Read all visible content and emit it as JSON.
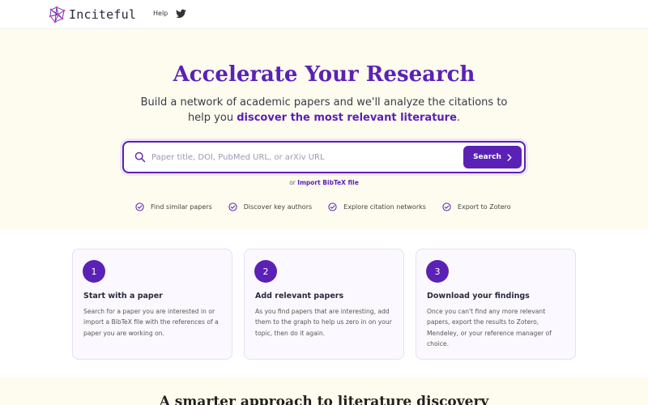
{
  "brand": {
    "name": "Inciteful",
    "accent": "#5b21b6"
  },
  "nav": {
    "help": "Help",
    "twitter_icon": "twitter-icon"
  },
  "hero": {
    "title": "Accelerate Your Research",
    "sub_line1": "Build a network of academic papers and we'll analyze the citations to",
    "sub_line2_prefix": "help you ",
    "sub_line2_bold": "discover the most relevant literature",
    "sub_line2_suffix": "."
  },
  "search": {
    "placeholder": "Paper title, DOI, PubMed URL, or arXiv URL",
    "value": "",
    "button": "Search"
  },
  "import": {
    "prefix": "or ",
    "link": "Import BibTeX file"
  },
  "features": [
    "Find similar papers",
    "Discover key authors",
    "Explore citation networks",
    "Export to Zotero"
  ],
  "steps": [
    {
      "num": "1",
      "title": "Start with a paper",
      "text": "Search for a paper you are interested in or import a BibTeX file with the references of a paper you are working on."
    },
    {
      "num": "2",
      "title": "Add relevant papers",
      "text": "As you find papers that are interesting, add them to the graph to help us zero in on your topic, then do it again."
    },
    {
      "num": "3",
      "title": "Download your findings",
      "text": "Once you can't find any more relevant papers, export the results to Zotero, Mendeley, or your reference manager of choice."
    }
  ],
  "bottom": {
    "title": "A smarter approach to literature discovery"
  }
}
